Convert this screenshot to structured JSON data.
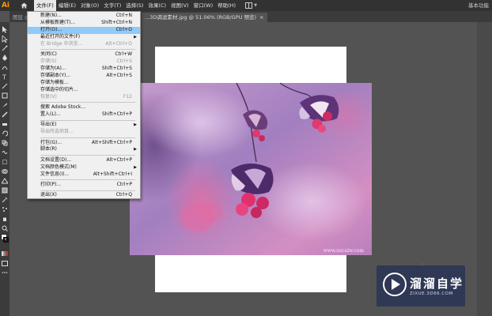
{
  "app": {
    "logo": "Ai",
    "workspace": "基本功能"
  },
  "menubar": {
    "items": [
      "文件(F)",
      "编辑(E)",
      "对象(O)",
      "文字(T)",
      "选择(S)",
      "效果(C)",
      "视图(V)",
      "窗口(W)",
      "帮助(H)"
    ],
    "active_index": 0
  },
  "tabs": {
    "previous": "图层 @",
    "active": "...3D调滤素材.jpg @ 51.06% (RGB/GPU 预览)",
    "close_glyph": "×"
  },
  "file_menu": {
    "items": [
      {
        "label": "新建(N)...",
        "shortcut": "Ctrl+N",
        "enabled": true
      },
      {
        "label": "从模板新建(T)...",
        "shortcut": "Shift+Ctrl+N",
        "enabled": true
      },
      {
        "label": "打开(O)...",
        "shortcut": "Ctrl+O",
        "enabled": true,
        "highlighted": true
      },
      {
        "label": "最近打开的文件(F)",
        "shortcut": "",
        "enabled": true,
        "submenu": true
      },
      {
        "label": "在 Bridge 中浏览...",
        "shortcut": "Alt+Ctrl+O",
        "enabled": false
      },
      {
        "separator": true
      },
      {
        "label": "关闭(C)",
        "shortcut": "Ctrl+W",
        "enabled": true
      },
      {
        "label": "存储(S)",
        "shortcut": "Ctrl+S",
        "enabled": false
      },
      {
        "label": "存储为(A)...",
        "shortcut": "Shift+Ctrl+S",
        "enabled": true
      },
      {
        "label": "存储副本(Y)...",
        "shortcut": "Alt+Ctrl+S",
        "enabled": true
      },
      {
        "label": "存储为模板...",
        "shortcut": "",
        "enabled": true
      },
      {
        "label": "存储选中的切片...",
        "shortcut": "",
        "enabled": true
      },
      {
        "label": "恢复(V)",
        "shortcut": "F12",
        "enabled": false
      },
      {
        "separator": true
      },
      {
        "label": "搜索 Adobe Stock...",
        "shortcut": "",
        "enabled": true
      },
      {
        "label": "置入(L)...",
        "shortcut": "Shift+Ctrl+P",
        "enabled": true
      },
      {
        "separator": true
      },
      {
        "label": "导出(E)",
        "shortcut": "",
        "enabled": true,
        "submenu": true
      },
      {
        "label": "导出所选项目...",
        "shortcut": "",
        "enabled": false
      },
      {
        "separator": true
      },
      {
        "label": "打包(G)...",
        "shortcut": "Alt+Shift+Ctrl+P",
        "enabled": true
      },
      {
        "label": "脚本(R)",
        "shortcut": "",
        "enabled": true,
        "submenu": true
      },
      {
        "separator": true
      },
      {
        "label": "文档设置(D)...",
        "shortcut": "Alt+Ctrl+P",
        "enabled": true
      },
      {
        "label": "文档颜色模式(M)",
        "shortcut": "",
        "enabled": true,
        "submenu": true
      },
      {
        "label": "文件信息(I)...",
        "shortcut": "Alt+Shift+Ctrl+I",
        "enabled": true
      },
      {
        "separator": true
      },
      {
        "label": "打印(P)...",
        "shortcut": "Ctrl+P",
        "enabled": true
      },
      {
        "separator": true
      },
      {
        "label": "退出(X)",
        "shortcut": "Ctrl+Q",
        "enabled": true
      }
    ]
  },
  "canvas": {
    "photo_watermark": "www.sucaiw.com",
    "dots": "∴"
  },
  "brand": {
    "name": "溜溜自学",
    "url": "ZIXUE.3D66.COM",
    "color": "#2a3456"
  },
  "colors": {
    "menu_highlight": "#91c9f7",
    "accent_logo": "#ff9a00"
  }
}
